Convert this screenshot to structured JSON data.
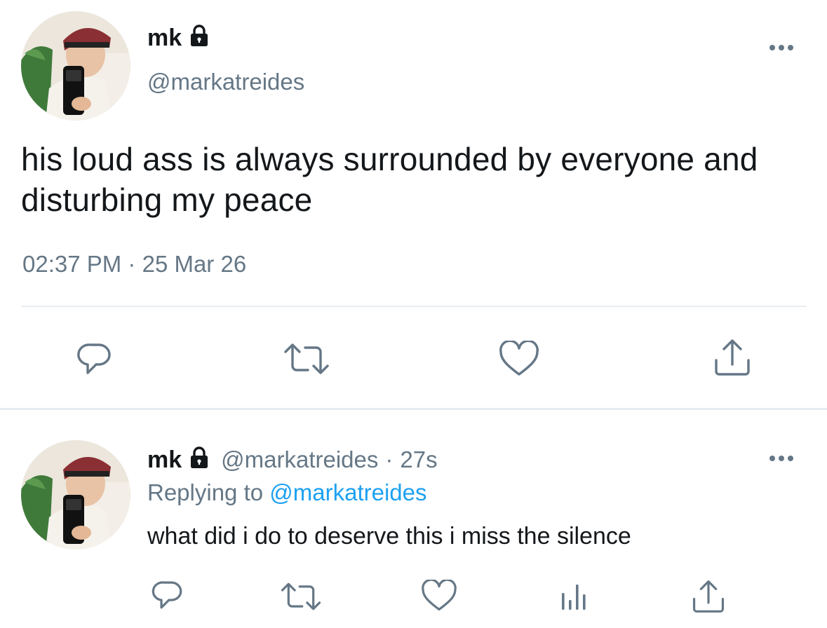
{
  "main_tweet": {
    "display_name": "mk",
    "handle": "@markatreides",
    "text": "his loud ass is always surrounded by everyone and disturbing my peace",
    "time": "02:37 PM",
    "separator": "·",
    "date": "25 Mar 26",
    "actions": [
      "reply-icon",
      "retweet-icon",
      "like-icon",
      "share-icon"
    ]
  },
  "reply_tweet": {
    "display_name": "mk",
    "handle": "@markatreides",
    "separator": "·",
    "age": "27s",
    "replying_prefix": "Replying to",
    "replying_handle": "@markatreides",
    "text": "what did i do to deserve this i miss the silence",
    "actions": [
      "reply-icon",
      "retweet-icon",
      "like-icon",
      "analytics-icon",
      "share-icon"
    ]
  },
  "colors": {
    "text": "#14171a",
    "secondary": "#657786",
    "link": "#1da1f2",
    "divider": "#e6ecf0"
  }
}
